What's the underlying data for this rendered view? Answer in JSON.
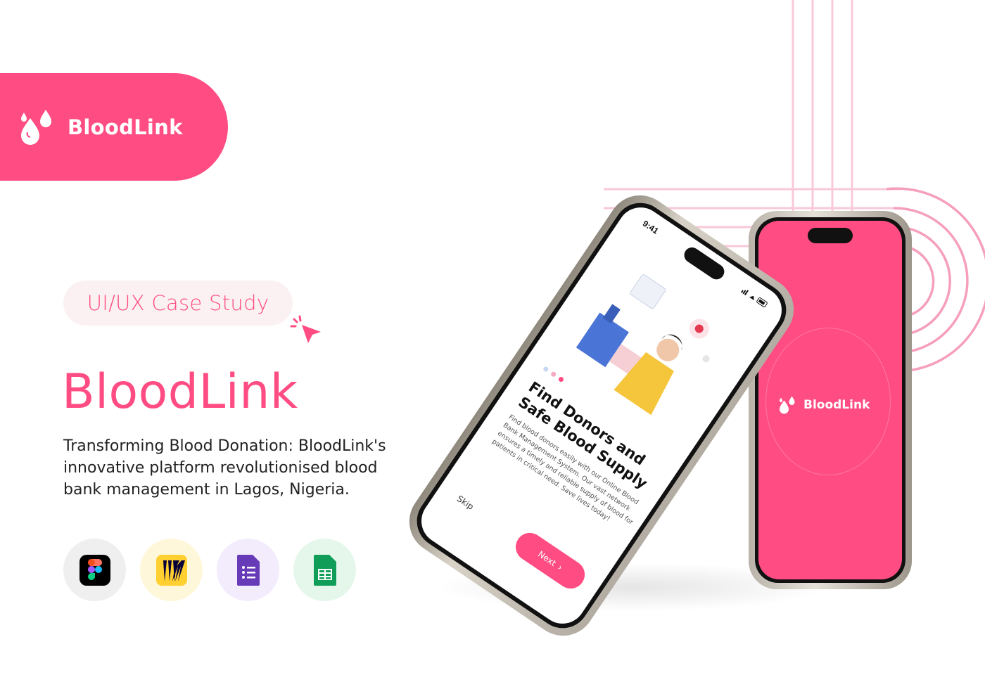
{
  "brand": {
    "name": "BloodLink",
    "color": "#ff4c82"
  },
  "tag": {
    "label": "UI/UX Case Study"
  },
  "hero": {
    "title": "BloodLink",
    "description": "Transforming Blood Donation: BloodLink's innovative platform revolutionised blood bank management in Lagos, Nigeria."
  },
  "tools": [
    {
      "name": "figma-icon",
      "bg": "#efefef"
    },
    {
      "name": "miro-icon",
      "bg": "#fff7da"
    },
    {
      "name": "google-forms-icon",
      "bg": "#f2ecfc"
    },
    {
      "name": "google-sheets-icon",
      "bg": "#e5f7eb"
    }
  ],
  "phone_onboarding": {
    "time": "9:41",
    "title": "Find Donors and Safe Blood Supply",
    "text": "Find blood donors easily with our Online Blood Bank Management System. Our vast network ensures a timely and reliable supply of blood for patients in critical need. Save lives today!",
    "skip_label": "Skip",
    "next_label": "Next",
    "next_icon": "›"
  },
  "phone_splash": {
    "app_name": "BloodLink"
  }
}
